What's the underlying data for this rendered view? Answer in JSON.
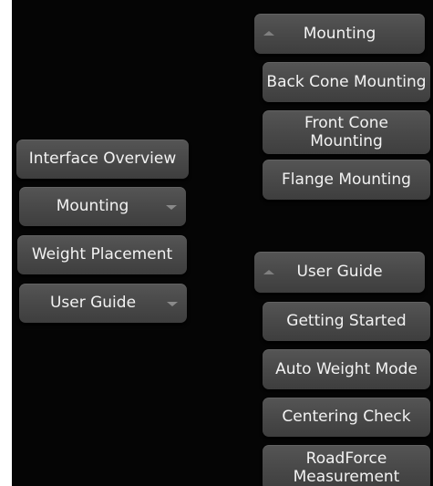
{
  "left_menu": {
    "interface_overview": "Interface Overview",
    "mounting": "Mounting",
    "weight_placement": "Weight Placement",
    "user_guide": "User Guide"
  },
  "mounting_menu": {
    "header": "Mounting",
    "items": [
      "Back Cone Mounting",
      "Front Cone Mounting",
      "Flange Mounting"
    ]
  },
  "user_guide_menu": {
    "header": "User Guide",
    "items": [
      "Getting Started",
      "Auto Weight Mode",
      "Centering Check",
      "RoadForce Measurement"
    ]
  },
  "icons": {
    "collapsed": "chevron-down-icon",
    "expanded": "chevron-up-icon"
  }
}
